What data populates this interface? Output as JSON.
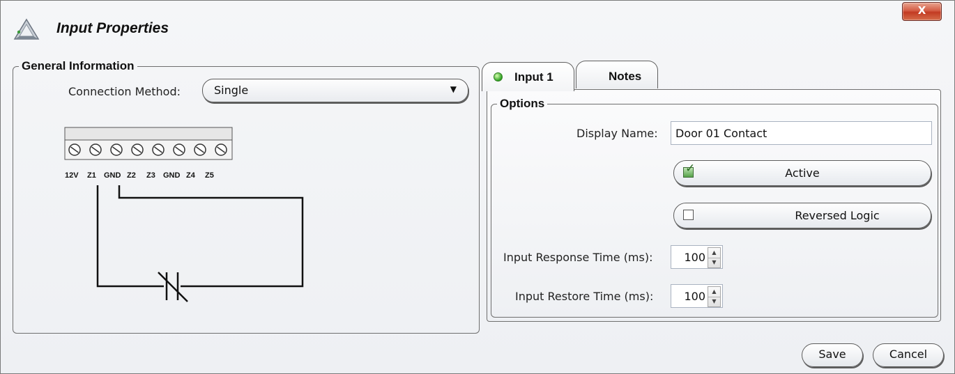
{
  "window": {
    "title": "Input Properties",
    "close_glyph": "X"
  },
  "general": {
    "legend": "General Information",
    "connection_label": "Connection Method:",
    "connection_value": "Single",
    "terminal_labels": [
      "12V",
      "Z1",
      "GND",
      "Z2",
      "Z3",
      "GND",
      "Z4",
      "Z5"
    ]
  },
  "tabs": [
    {
      "label": "Input 1",
      "active": true,
      "status_color": "#3bb02c"
    },
    {
      "label": "Notes",
      "active": false
    }
  ],
  "options": {
    "legend": "Options",
    "display_name_label": "Display Name:",
    "display_name_value": "Door 01 Contact",
    "active_label": "Active",
    "active_checked": true,
    "reversed_label": "Reversed Logic",
    "reversed_checked": false,
    "response_label": "Input Response Time (ms):",
    "response_value": "100",
    "restore_label": "Input Restore Time (ms):",
    "restore_value": "100"
  },
  "buttons": {
    "save": "Save",
    "cancel": "Cancel"
  },
  "icons": {
    "app": "triangle-logo-icon",
    "dropdown": "chevron-down-icon",
    "close": "close-icon",
    "spin_up": "spin-up-icon",
    "spin_down": "spin-down-icon"
  }
}
